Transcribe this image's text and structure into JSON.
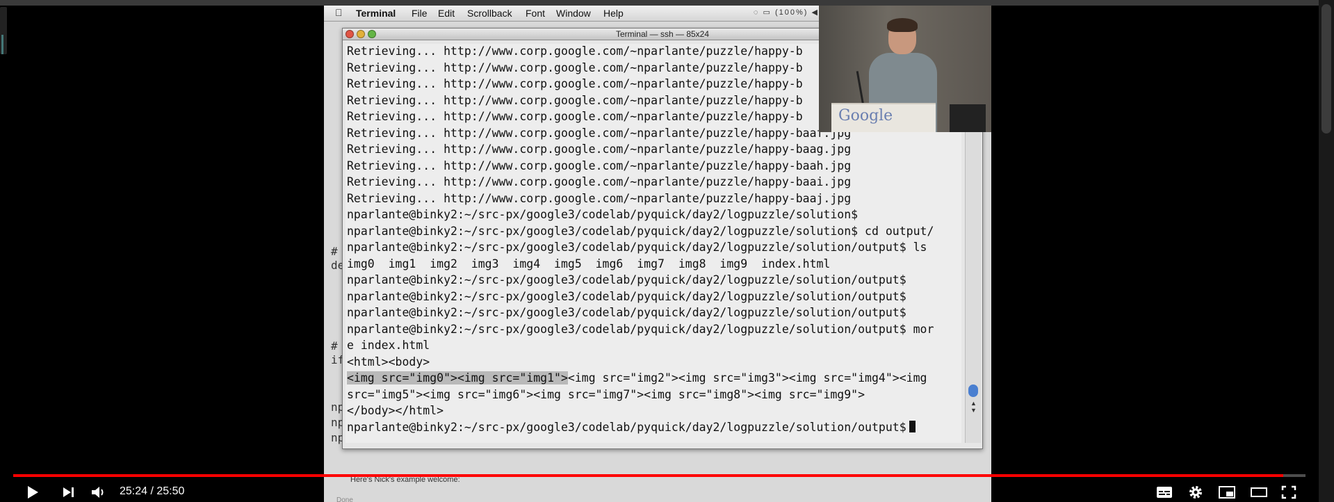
{
  "player": {
    "time": "25:24 / 25:50",
    "progress_fraction": 0.983,
    "progress_color": "#ff0000",
    "controls": {
      "play": "play-icon",
      "next": "next-icon",
      "volume": "volume-icon",
      "captions": "subtitles-icon",
      "settings": "gear-icon",
      "miniplayer": "miniplayer-icon",
      "theater": "theater-icon",
      "fullscreen": "fullscreen-icon"
    }
  },
  "mac": {
    "app_name": "Terminal",
    "menus": [
      "File",
      "Edit",
      "Scrollback",
      "Font",
      "Window",
      "Help"
    ],
    "battery": "(100%)",
    "terminal_title": "Terminal — ssh — 85x24"
  },
  "background": {
    "left_fragments": [
      "#",
      "de",
      "#",
      "if",
      "np",
      "np",
      "np"
    ],
    "caption": "Here's Nick's example welcome:",
    "status": "Done"
  },
  "terminal": {
    "lines": [
      "Retrieving... http://www.corp.google.com/~nparlante/puzzle/happy-b",
      "Retrieving... http://www.corp.google.com/~nparlante/puzzle/happy-b",
      "Retrieving... http://www.corp.google.com/~nparlante/puzzle/happy-b",
      "Retrieving... http://www.corp.google.com/~nparlante/puzzle/happy-b",
      "Retrieving... http://www.corp.google.com/~nparlante/puzzle/happy-b",
      "Retrieving... http://www.corp.google.com/~nparlante/puzzle/happy-baaf.jpg",
      "Retrieving... http://www.corp.google.com/~nparlante/puzzle/happy-baag.jpg",
      "Retrieving... http://www.corp.google.com/~nparlante/puzzle/happy-baah.jpg",
      "Retrieving... http://www.corp.google.com/~nparlante/puzzle/happy-baai.jpg",
      "Retrieving... http://www.corp.google.com/~nparlante/puzzle/happy-baaj.jpg",
      "nparlante@binky2:~/src-px/google3/codelab/pyquick/day2/logpuzzle/solution$",
      "nparlante@binky2:~/src-px/google3/codelab/pyquick/day2/logpuzzle/solution$ cd output/",
      "nparlante@binky2:~/src-px/google3/codelab/pyquick/day2/logpuzzle/solution/output$ ls",
      "img0  img1  img2  img3  img4  img5  img6  img7  img8  img9  index.html",
      "nparlante@binky2:~/src-px/google3/codelab/pyquick/day2/logpuzzle/solution/output$",
      "nparlante@binky2:~/src-px/google3/codelab/pyquick/day2/logpuzzle/solution/output$",
      "nparlante@binky2:~/src-px/google3/codelab/pyquick/day2/logpuzzle/solution/output$",
      "nparlante@binky2:~/src-px/google3/codelab/pyquick/day2/logpuzzle/solution/output$ mor",
      "e index.html",
      "<html><body>"
    ],
    "highlighted": "<img src=\"img0\"><img src=\"img1\">",
    "after_highlight": "<img src=\"img2\"><img src=\"img3\"><img src=\"img4\"><img",
    "lines_tail": [
      "src=\"img5\"><img src=\"img6\"><img src=\"img7\"><img src=\"img8\"><img src=\"img9\">",
      "</body></html>"
    ],
    "prompt": "nparlante@binky2:~/src-px/google3/codelab/pyquick/day2/logpuzzle/solution/output$"
  },
  "pip": {
    "logo_text": "Google"
  }
}
